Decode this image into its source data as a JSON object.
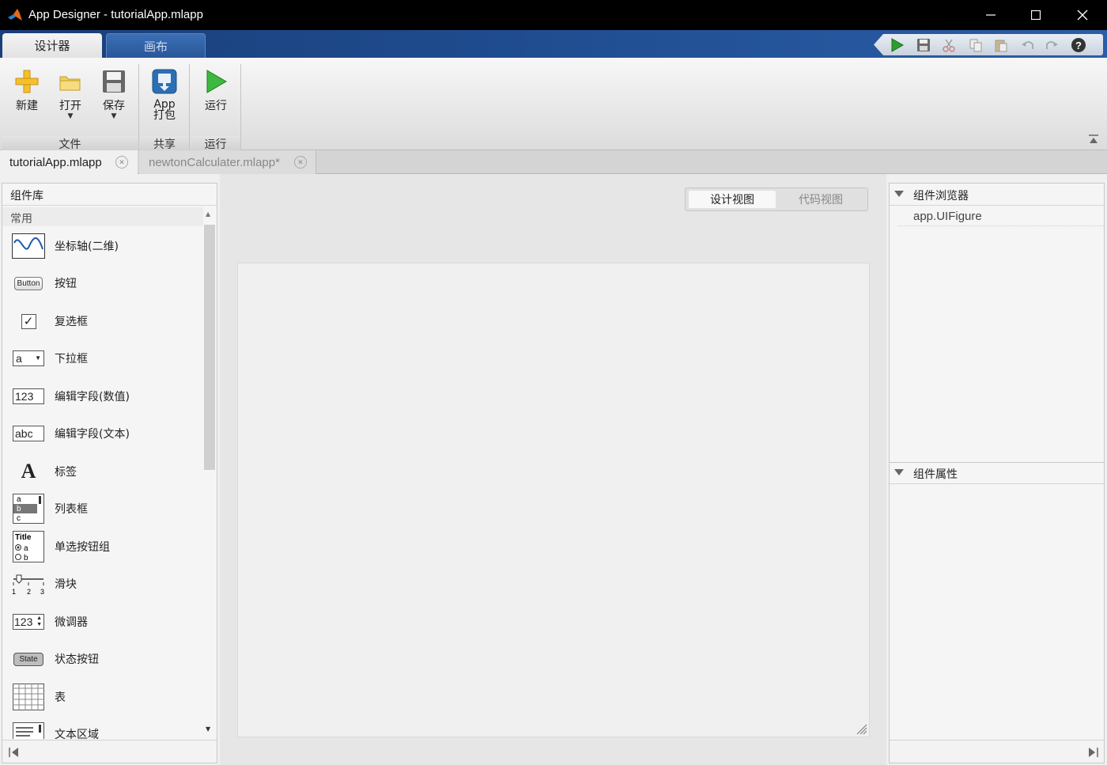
{
  "window": {
    "title": "App Designer - tutorialApp.mlapp"
  },
  "ribbon": {
    "tabs": [
      {
        "label": "设计器"
      },
      {
        "label": "画布"
      }
    ],
    "sections": [
      {
        "label": "文件",
        "buttons": [
          {
            "label": "新建"
          },
          {
            "label": "打开"
          },
          {
            "label": "保存"
          }
        ]
      },
      {
        "label": "共享",
        "buttons": [
          {
            "label_line1": "App",
            "label_line2": "打包"
          }
        ]
      },
      {
        "label": "运行",
        "buttons": [
          {
            "label": "运行"
          }
        ]
      }
    ]
  },
  "documents": [
    {
      "label": "tutorialApp.mlapp",
      "active": true
    },
    {
      "label": "newtonCalculater.mlapp*",
      "active": false
    }
  ],
  "library": {
    "title": "组件库",
    "category": "常用",
    "items": [
      {
        "label": "坐标轴(二维)",
        "icon": "axes-icon"
      },
      {
        "label": "按钮",
        "icon": "button-icon",
        "icon_text": "Button"
      },
      {
        "label": "复选框",
        "icon": "checkbox-icon",
        "icon_text": "✓"
      },
      {
        "label": "下拉框",
        "icon": "dropdown-icon",
        "icon_text": "a"
      },
      {
        "label": "编辑字段(数值)",
        "icon": "numeric-field-icon",
        "icon_text": "123"
      },
      {
        "label": "编辑字段(文本)",
        "icon": "text-field-icon",
        "icon_text": "abc"
      },
      {
        "label": "标签",
        "icon": "label-icon",
        "icon_text": "A"
      },
      {
        "label": "列表框",
        "icon": "listbox-icon",
        "icon_text": "a b c"
      },
      {
        "label": "单选按钮组",
        "icon": "radio-group-icon",
        "icon_text": "Title a b"
      },
      {
        "label": "滑块",
        "icon": "slider-icon",
        "icon_text": "1 2 3"
      },
      {
        "label": "微调器",
        "icon": "spinner-icon",
        "icon_text": "123"
      },
      {
        "label": "状态按钮",
        "icon": "state-button-icon",
        "icon_text": "State"
      },
      {
        "label": "表",
        "icon": "table-icon"
      },
      {
        "label": "文本区域",
        "icon": "text-area-icon"
      }
    ]
  },
  "view_toggle": {
    "design": "设计视图",
    "code": "代码视图",
    "selected": "设计视图"
  },
  "browser": {
    "title": "组件浏览器",
    "items": [
      "app.UIFigure"
    ]
  },
  "properties": {
    "title": "组件属性"
  },
  "colors": {
    "ribbon_blue": "#1e4a8c",
    "run_green": "#2e9e2e",
    "title_bar": "#000000"
  }
}
